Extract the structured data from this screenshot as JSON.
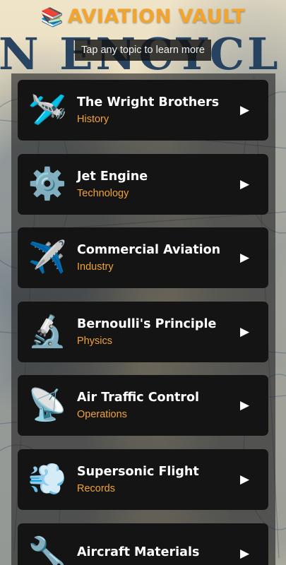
{
  "header": {
    "icon": "books-icon",
    "title": "AVIATION VAULT",
    "subtitle": "Tap any topic to learn more"
  },
  "background": {
    "text": "ON ENCYCL"
  },
  "topics": [
    {
      "title": "The Wright Brothers",
      "category": "History",
      "icon": "small-airplane-icon",
      "glyph": "🛩️"
    },
    {
      "title": "Jet Engine",
      "category": "Technology",
      "icon": "gear-icon",
      "glyph": "⚙️"
    },
    {
      "title": "Commercial Aviation",
      "category": "Industry",
      "icon": "airplane-icon",
      "glyph": "✈️"
    },
    {
      "title": "Bernoulli's Principle",
      "category": "Physics",
      "icon": "microscope-icon",
      "glyph": "🔬"
    },
    {
      "title": "Air Traffic Control",
      "category": "Operations",
      "icon": "satellite-dish-icon",
      "glyph": "📡"
    },
    {
      "title": "Supersonic Flight",
      "category": "Records",
      "icon": "wind-icon",
      "glyph": "💨"
    },
    {
      "title": "Aircraft Materials",
      "category": "",
      "icon": "wrench-icon",
      "glyph": "🔧"
    }
  ],
  "arrow_glyph": "▶",
  "colors": {
    "accent": "#f3a42c",
    "category": "#f0a33a",
    "card": "#141414"
  }
}
